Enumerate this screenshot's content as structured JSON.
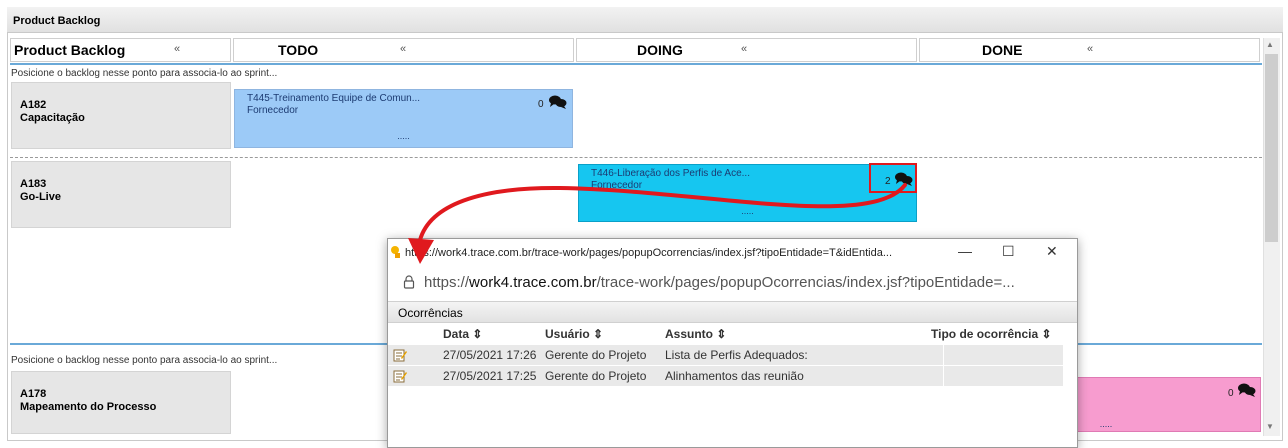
{
  "panel": {
    "title": "Product Backlog"
  },
  "columns": [
    {
      "label": "Product Backlog",
      "chevron": "«"
    },
    {
      "label": "TODO",
      "chevron": "«"
    },
    {
      "label": "DOING",
      "chevron": "«"
    },
    {
      "label": "DONE",
      "chevron": "«"
    }
  ],
  "hint_text": "Posicione o backlog nesse ponto para associa-lo ao sprint...",
  "backlogs": [
    {
      "code": "A182",
      "name": "Capacitação"
    },
    {
      "code": "A183",
      "name": "Go-Live"
    },
    {
      "code": "A178",
      "name": "Mapeamento do Processo"
    }
  ],
  "tasks": [
    {
      "title": "T445-Treinamento Equipe de Comun...",
      "owner": "Fornecedor",
      "dots": ".....",
      "count": "0",
      "color": "#9ccaf7"
    },
    {
      "title": "T446-Liberação dos Perfis de Ace...",
      "owner": "Fornecedor",
      "dots": ".....",
      "count": "2",
      "color": "#16c6f0"
    },
    {
      "count": "0",
      "dots": ".....",
      "color": "#f79ccf"
    }
  ],
  "popup": {
    "title_url": "https://work4.trace.com.br/trace-work/pages/popupOcorrencias/index.jsf?tipoEntidade=T&idEntida...",
    "address_prefix": "https://",
    "address_host": "work4.trace.com.br",
    "address_path": "/trace-work/pages/popupOcorrencias/index.jsf?tipoEntidade=...",
    "section": "Ocorrências",
    "headers": {
      "data": "Data",
      "usuario": "Usuário",
      "assunto": "Assunto",
      "tipo": "Tipo de ocorrência"
    },
    "rows": [
      {
        "data": "27/05/2021 17:26",
        "usuario": "Gerente do Projeto",
        "assunto": "Lista de Perfis Adequados:",
        "tipo": ""
      },
      {
        "data": "27/05/2021 17:25",
        "usuario": "Gerente do Projeto",
        "assunto": "Alinhamentos das reunião",
        "tipo": ""
      }
    ],
    "win_controls": {
      "minimize": "—",
      "maximize": "☐",
      "close": "✕"
    }
  },
  "colors": {
    "highlight": "#e0191e",
    "accent_blue": "#6aa9d8"
  },
  "icons": [
    "comments-icon",
    "edit-note-icon",
    "lock-icon",
    "sort-icon",
    "collapse-icon"
  ]
}
